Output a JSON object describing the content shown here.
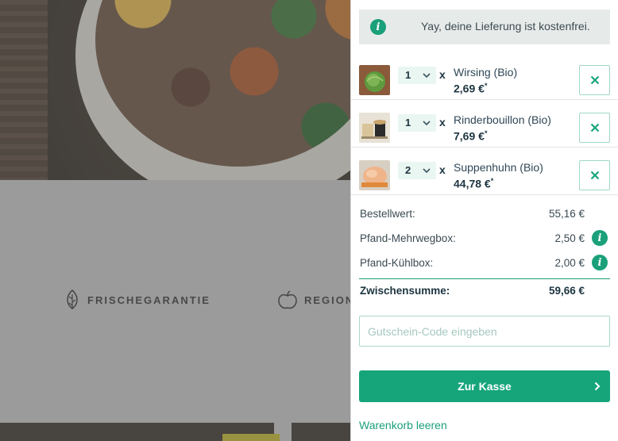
{
  "background": {
    "features": [
      {
        "label": "FRISCHEGARANTIE",
        "icon": "leaf-icon"
      },
      {
        "label": "REGION",
        "icon": "apple-icon"
      }
    ]
  },
  "cart": {
    "notice": "Yay, deine Lieferung ist kostenfrei.",
    "items": [
      {
        "qty": "1",
        "name": "Wirsing (Bio)",
        "price": "2,69 €",
        "price_mark": "*"
      },
      {
        "qty": "1",
        "name": "Rinderbouillon (Bio)",
        "price": "7,69 €",
        "price_mark": "*"
      },
      {
        "qty": "2",
        "name": "Suppenhuhn (Bio)",
        "price": "44,78 €",
        "price_mark": "*"
      }
    ],
    "times_symbol": "x",
    "totals": {
      "order_value_label": "Bestellwert:",
      "order_value": "55,16 €",
      "deposit_box_label": "Pfand-Mehrwegbox:",
      "deposit_box": "2,50 €",
      "deposit_cool_label": "Pfand-Kühlbox:",
      "deposit_cool": "2,00 €",
      "subtotal_label": "Zwischensumme:",
      "subtotal": "59,66 €"
    },
    "voucher_placeholder": "Gutschein-Code eingeben",
    "checkout_label": "Zur Kasse",
    "empty_cart_label": "Warenkorb leeren",
    "accent_color": "#16a57b"
  }
}
